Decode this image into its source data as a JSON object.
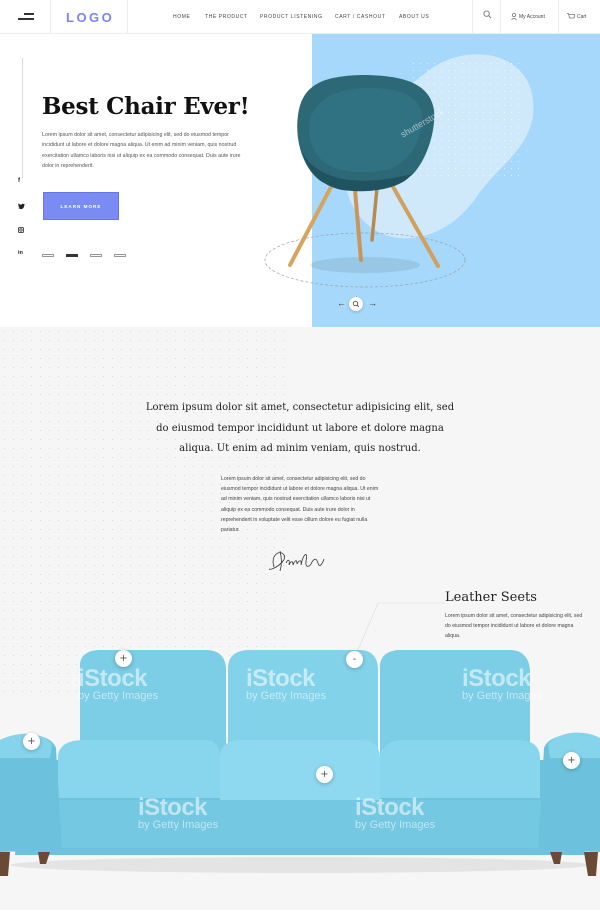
{
  "nav": {
    "logo": "LOGO",
    "links": [
      "HOME",
      "THE PRODUCT",
      "PRODUCT LISTENING",
      "CART / CASHOUT",
      "ABOUT US"
    ],
    "account": "My Account",
    "cart": "Cart"
  },
  "hero": {
    "title": "Best Chair Ever!",
    "text": "Lorem ipsum dolor sit amet, consectetur adipisicing elit, sed do eiusmod tempor incididunt ut labore et dolore magna aliqua. Ut enim ad minim veniam, quis nostrud exercitation ullamco laboris nisi ut aliquip ex ea commodo consequat. Duis aute irure dolor in reprehenderit.",
    "button": "LEARN MORE",
    "social": [
      "f",
      "t",
      "ig",
      "in"
    ],
    "watermark": "shutterstock"
  },
  "intro": {
    "quote": "Lorem ipsum dolor sit amet, consectetur adipisicing elit, sed do eiusmod tempor incididunt ut labore et dolore magna aliqua. Ut enim ad minim veniam, quis nostrud.",
    "body": "Lorem ipsum dolor sit amet, consectetur adipisicing elit, sed do eiusmod tempor incididunt ut labore et dolore magna aliqua. Ut enim ad minim veniam, quis nostrud exercitation ullamco laboris nisi ut aliquip ex ea commodo consequat. Duis aute irure dolor in reprehenderit in voluptate velit esse cillum dolore eu fugiat nulla pariatur."
  },
  "feature": {
    "title": "Leather Seets",
    "text": "Lorem ipsum dolor sit amet, consectetur adipisicing elit, sed do eiusmod tempor incididunt ut labore et dolore magna aliqua."
  },
  "watermark": {
    "brand": "iStock",
    "sub": "by Getty Images"
  },
  "hotspots": [
    "+",
    "-",
    "+",
    "+",
    "+"
  ],
  "colors": {
    "accent": "#7a8cf3",
    "hero_blue": "#a5d8fa",
    "sofa": "#7fd0e8",
    "chair": "#2c6876"
  }
}
